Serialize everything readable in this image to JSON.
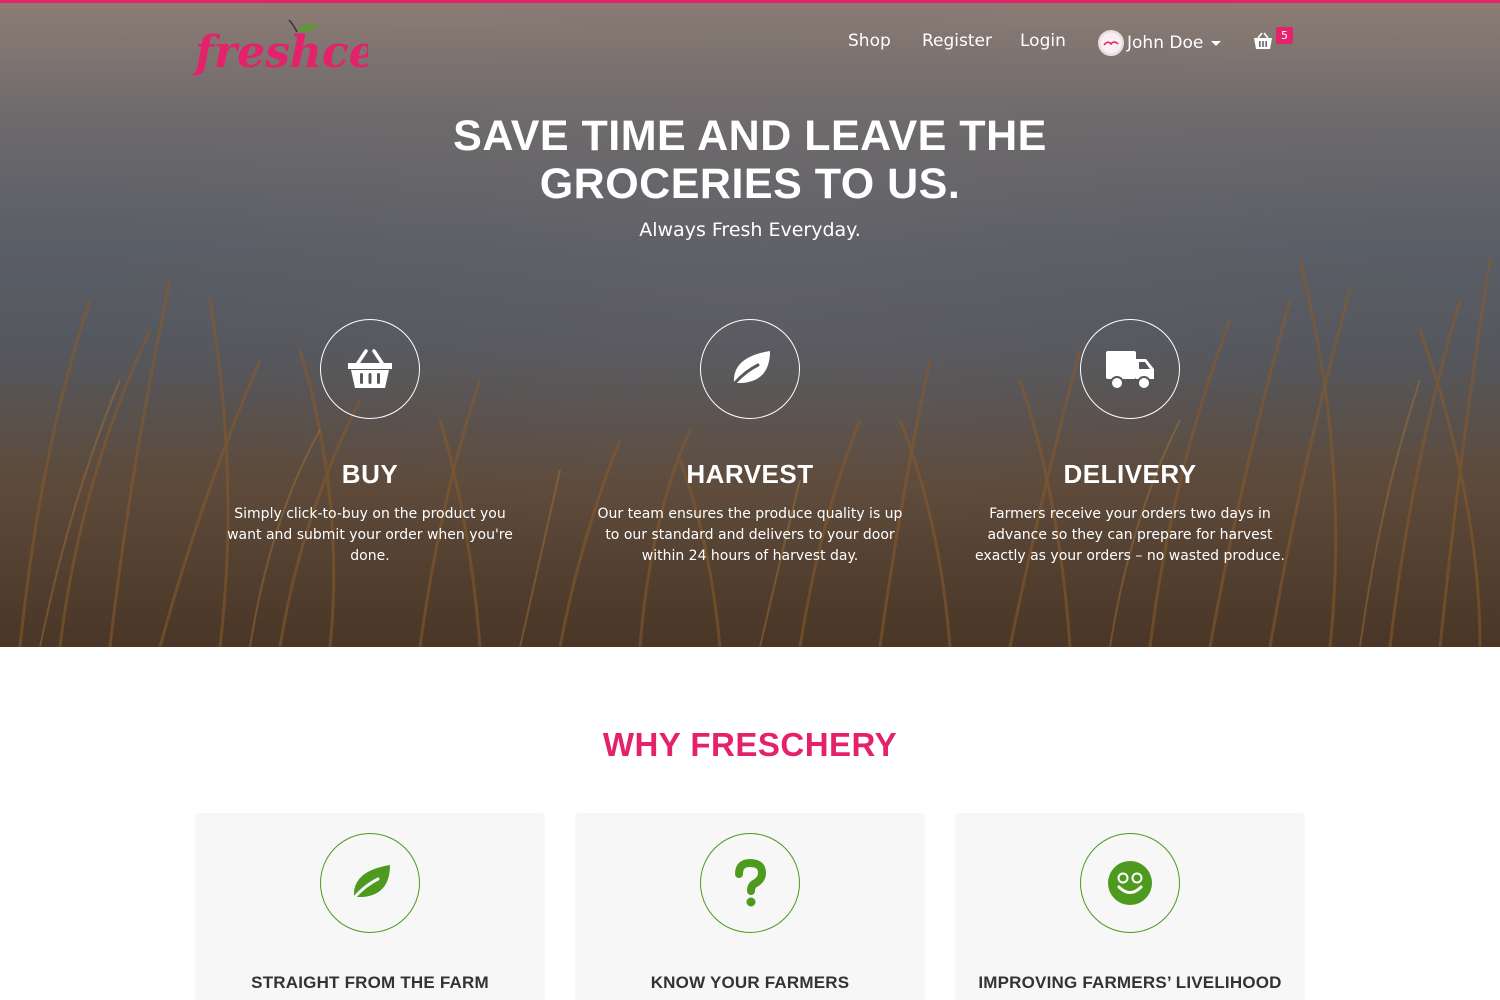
{
  "brand": {
    "logo_text": "freshcery",
    "accent_color": "#e3226b",
    "green_color": "#4d9a1f"
  },
  "nav": {
    "shop": "Shop",
    "register": "Register",
    "login": "Login",
    "user_name": "John Doe",
    "cart_icon": "basket-icon",
    "cart_count": "5"
  },
  "hero": {
    "title": "SAVE TIME AND LEAVE THE GROCERIES TO US.",
    "subtitle": "Always Fresh Everyday.",
    "features": [
      {
        "icon": "basket-icon",
        "title": "BUY",
        "text": "Simply click-to-buy on the product you want and submit your order when you're done."
      },
      {
        "icon": "leaf-icon",
        "title": "HARVEST",
        "text": "Our team ensures the produce quality is up to our standard and delivers to your door within 24 hours of harvest day."
      },
      {
        "icon": "truck-icon",
        "title": "DELIVERY",
        "text": "Farmers receive your orders two days in advance so they can prepare for harvest exactly as your orders – no wasted produce."
      }
    ]
  },
  "why": {
    "title": "WHY FRESCHERY",
    "cards": [
      {
        "icon": "leaf-icon",
        "title": "STRAIGHT FROM THE FARM"
      },
      {
        "icon": "question-icon",
        "title": "KNOW YOUR FARMERS"
      },
      {
        "icon": "smiley-icon",
        "title": "IMPROVING FARMERS’ LIVELIHOOD"
      }
    ]
  }
}
